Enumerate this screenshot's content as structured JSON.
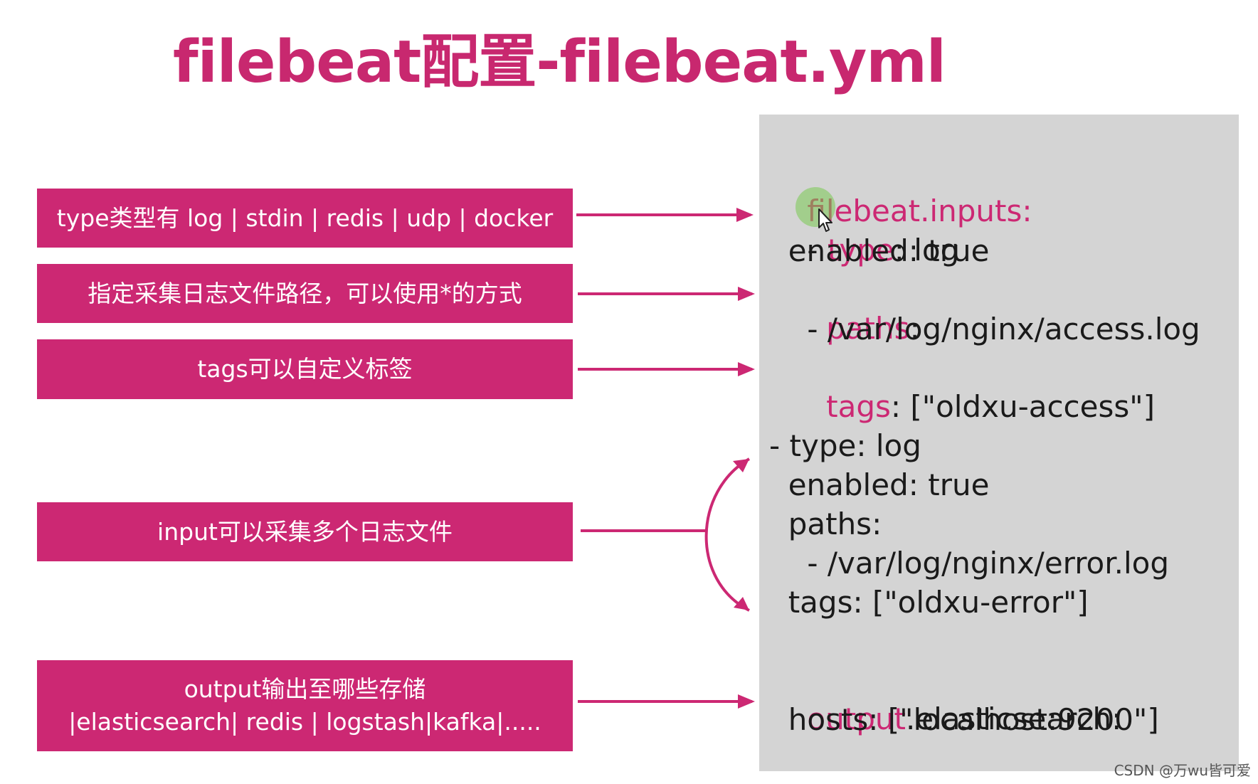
{
  "title": "filebeat配置-filebeat.yml",
  "labels": {
    "type_options": "type类型有 log | stdin | redis | udp | docker",
    "paths_hint": "指定采集日志文件路径，可以使用*的方式",
    "tags_hint": "tags可以自定义标签",
    "multi_input": "input可以采集多个日志文件",
    "output_line1": "output输出至哪些存储",
    "output_line2": "|elasticsearch| redis | logstash|kafka|....."
  },
  "code": {
    "inputs_key": "filebeat.inputs:",
    "type1_dash": "- ",
    "type1_key": "type",
    "type1_value": ": log",
    "enabled1": "  enabled: true",
    "paths1_indent": "  ",
    "paths1_key": "paths",
    "paths1_colon": ":",
    "path1": "    - /var/log/nginx/access.log",
    "tags1_indent": "  ",
    "tags1_key": "tags",
    "tags1_value": ": [\"oldxu-access\"]",
    "type2": "- type: log",
    "enabled2": "  enabled: true",
    "paths2": "  paths:",
    "path2": "    - /var/log/nginx/error.log",
    "tags2": "  tags: [\"oldxu-error\"]",
    "output_key": "output",
    "output_rest": ".elasticsearch:",
    "hosts": "  hosts: [\"localhost:9200\"]"
  },
  "watermark": "CSDN @万wu皆可爱",
  "colors": {
    "accent": "#cc2873",
    "title": "#c8286f",
    "panel": "#d4d4d4",
    "text": "#1a1a1a"
  }
}
